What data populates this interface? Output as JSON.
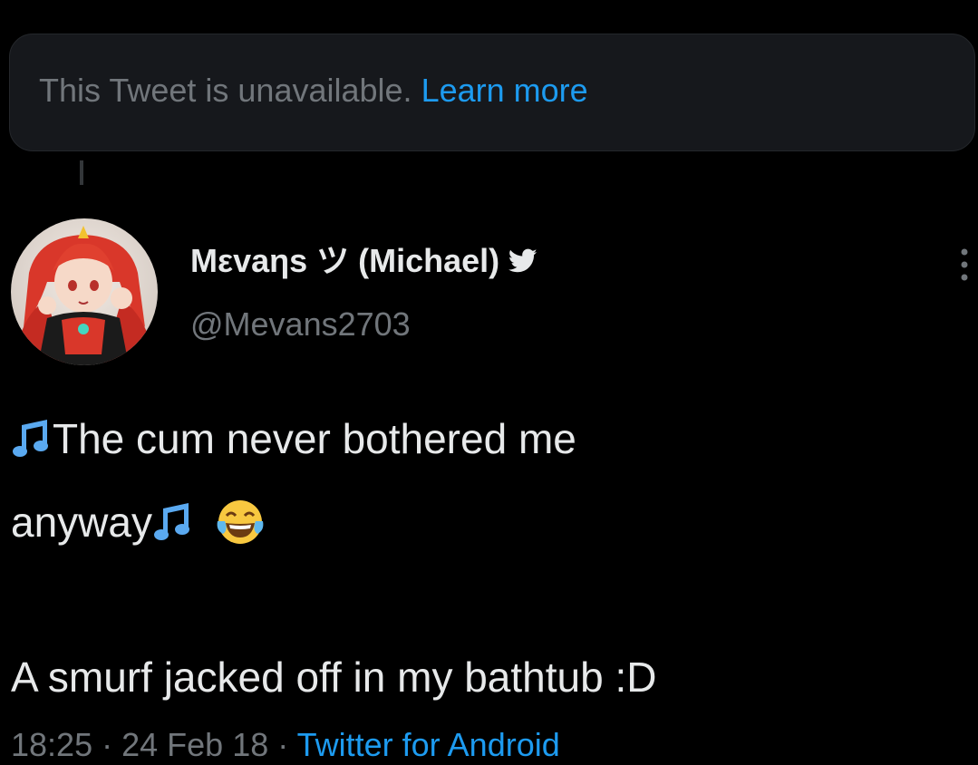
{
  "unavailable_notice": {
    "text": "This Tweet is unavailable.",
    "link": "Learn more"
  },
  "author": {
    "display_name": "Mεvaηs ツ (Michael)",
    "handle": "@Mevans2703",
    "verified_icon": "twitter-bird-icon"
  },
  "tweet": {
    "line1": "The cum never bothered me",
    "line2": "anyway",
    "line3": "A smurf jacked off in my bathtub :D",
    "emojis": [
      "musical-notes-emoji",
      "tears-of-joy-emoji"
    ]
  },
  "meta": {
    "time": "18:25",
    "separator": "·",
    "date": "24 Feb 18",
    "source": "Twitter for Android"
  },
  "colors": {
    "background": "#000000",
    "card": "#16181c",
    "text": "#e7e9ea",
    "muted": "#71767b",
    "accent": "#1d9bf0"
  }
}
